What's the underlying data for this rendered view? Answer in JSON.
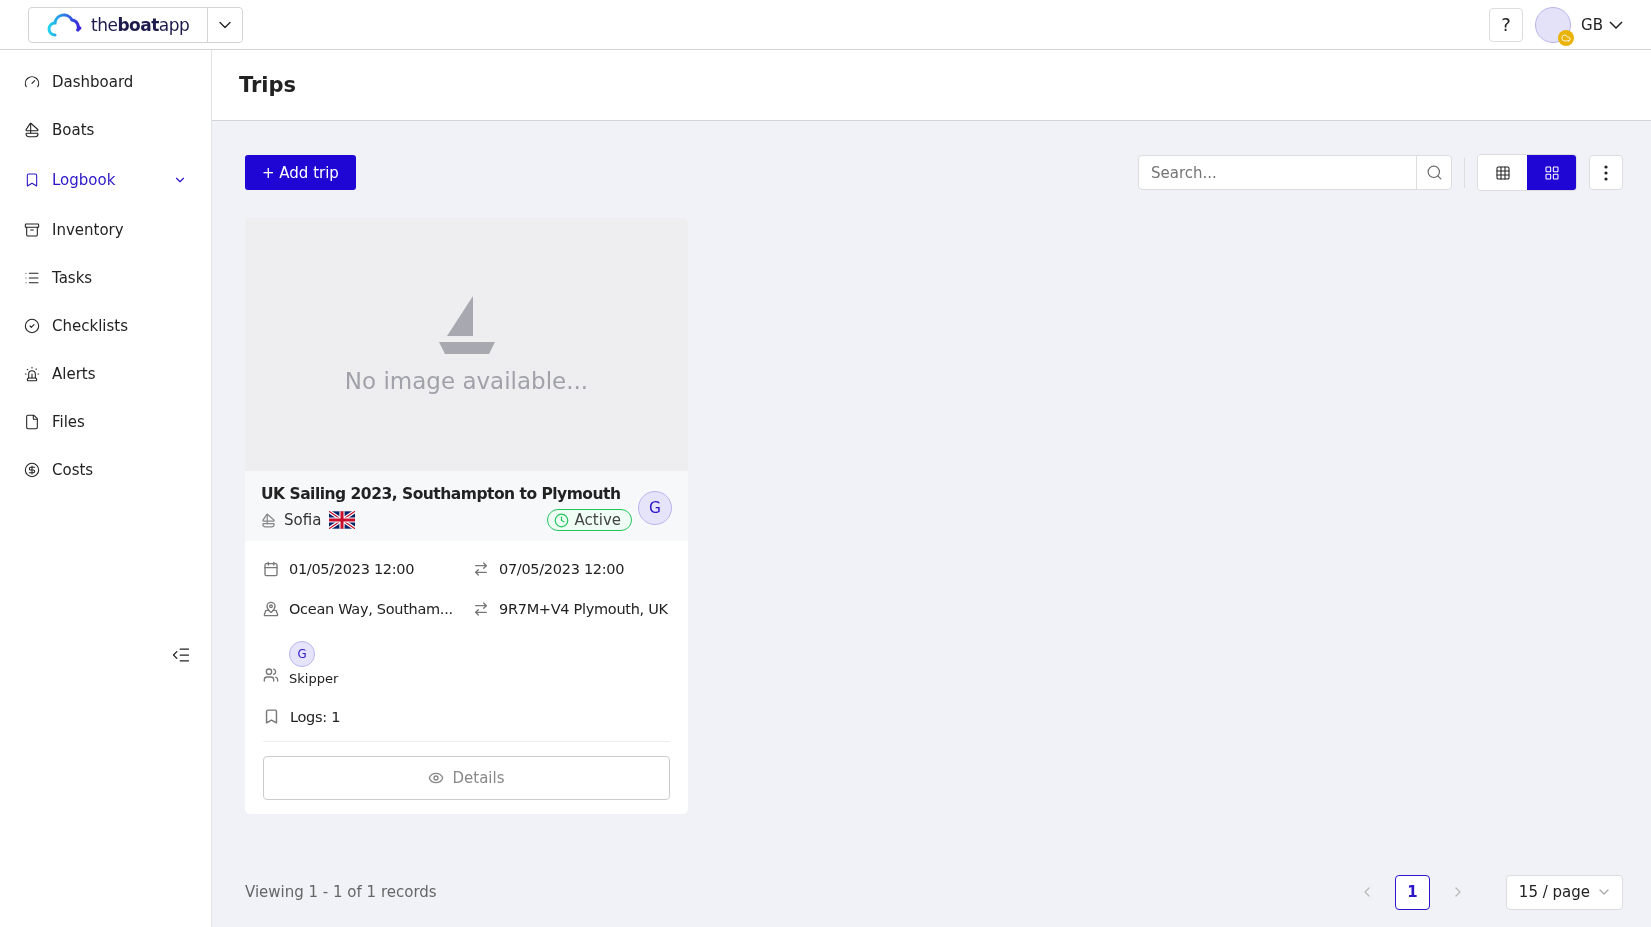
{
  "header": {
    "logo": "the**boat**app",
    "help": "?",
    "user": {
      "initials": "GB"
    }
  },
  "sidebar": {
    "items": [
      {
        "label": "Dashboard",
        "selected": false
      },
      {
        "label": "Boats",
        "selected": false
      },
      {
        "label": "Logbook",
        "selected": true,
        "expanded": false
      },
      {
        "label": "Inventory",
        "selected": false
      },
      {
        "label": "Tasks",
        "selected": false
      },
      {
        "label": "Checklists",
        "selected": false
      },
      {
        "label": "Alerts",
        "selected": false
      },
      {
        "label": "Files",
        "selected": false
      },
      {
        "label": "Costs",
        "selected": false
      }
    ]
  },
  "page": {
    "title": "Trips"
  },
  "toolbar": {
    "add_button": "+ Add trip",
    "search": {
      "placeholder": "Search..."
    },
    "views": [
      {
        "selected": false
      },
      {
        "selected": true
      }
    ]
  },
  "cards": [
    {
      "image_text": "No image available...",
      "title": "UK Sailing 2023, Southampton to Plymouth",
      "owner": "G",
      "boat": "Sofia",
      "status": {
        "label": "Active",
        "kind": "active"
      },
      "start": "01/05/2023 12:00",
      "end": "07/05/2023 12:00",
      "from": "Ocean Way, Southam...",
      "to": "9R7M+V4 Plymouth, UK",
      "crew": [
        {
          "initial": "G",
          "role": "Skipper"
        }
      ],
      "logs": "Logs: 1",
      "details_button": "Details"
    }
  ],
  "footer": {
    "summary": "Viewing 1 - 1 of 1 records",
    "prev_disabled": true,
    "next_disabled": true,
    "pages": [
      {
        "label": "1",
        "selected": true
      }
    ],
    "page_size": "15 / page"
  }
}
